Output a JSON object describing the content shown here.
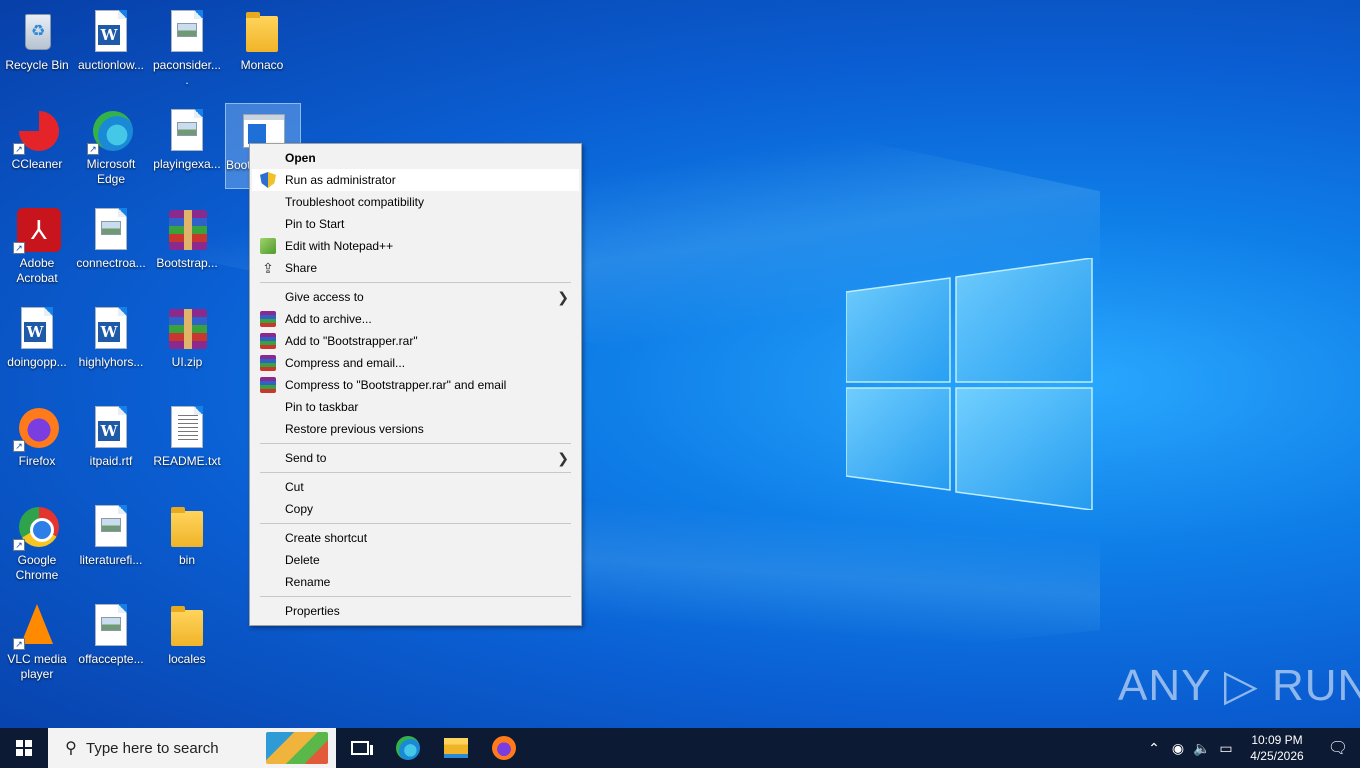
{
  "desktop": {
    "icons": [
      {
        "label": "Recycle Bin"
      },
      {
        "label": "auctionlow..."
      },
      {
        "label": "paconsider...."
      },
      {
        "label": "Monaco"
      },
      {
        "label": "CCleaner"
      },
      {
        "label": "Microsoft Edge"
      },
      {
        "label": "playingexa..."
      },
      {
        "label": "Boot"
      },
      {
        "label": "Adobe Acrobat"
      },
      {
        "label": "connectroa..."
      },
      {
        "label": "Bootstrap..."
      },
      {
        "label": "doingopp..."
      },
      {
        "label": "highlyhors..."
      },
      {
        "label": "UI.zip"
      },
      {
        "label": "Firefox"
      },
      {
        "label": "itpaid.rtf"
      },
      {
        "label": "README.txt"
      },
      {
        "label": "Google Chrome"
      },
      {
        "label": "literaturefi..."
      },
      {
        "label": "bin"
      },
      {
        "label": "VLC media player"
      },
      {
        "label": "offaccepte..."
      },
      {
        "label": "locales"
      }
    ]
  },
  "context_menu": {
    "items": [
      {
        "label": "Open"
      },
      {
        "label": "Run as administrator"
      },
      {
        "label": "Troubleshoot compatibility"
      },
      {
        "label": "Pin to Start"
      },
      {
        "label": "Edit with Notepad++"
      },
      {
        "label": "Share"
      },
      {
        "label": "Give access to"
      },
      {
        "label": "Add to archive..."
      },
      {
        "label": "Add to \"Bootstrapper.rar\""
      },
      {
        "label": "Compress and email..."
      },
      {
        "label": "Compress to \"Bootstrapper.rar\" and email"
      },
      {
        "label": "Pin to taskbar"
      },
      {
        "label": "Restore previous versions"
      },
      {
        "label": "Send to"
      },
      {
        "label": "Cut"
      },
      {
        "label": "Copy"
      },
      {
        "label": "Create shortcut"
      },
      {
        "label": "Delete"
      },
      {
        "label": "Rename"
      },
      {
        "label": "Properties"
      }
    ]
  },
  "watermark": {
    "text": "ANY ▷ RUN"
  },
  "taskbar": {
    "search_placeholder": "Type here to search",
    "clock_time": "10:09 PM",
    "clock_date": "4/25/2026"
  },
  "colors": {
    "taskbar_bg": "#0c1a33",
    "menu_bg": "#f2f2f2",
    "menu_highlight": "#ffffff",
    "wallpaper_accent": "#0a5ed2"
  }
}
